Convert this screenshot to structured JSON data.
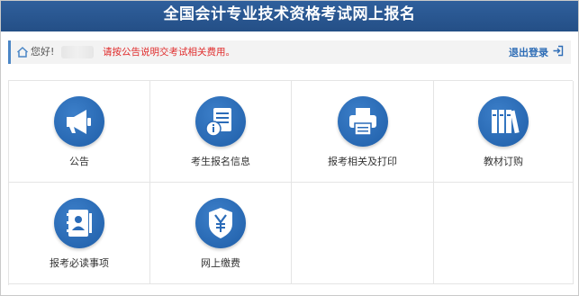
{
  "header": {
    "title": "全国会计专业技术资格考试网上报名"
  },
  "notice": {
    "greeting": "您好!",
    "message": "请按公告说明交考试相关费用。",
    "logout_label": "退出登录"
  },
  "tiles": [
    {
      "label": "公告",
      "icon": "megaphone-icon"
    },
    {
      "label": "考生报名信息",
      "icon": "info-document-icon"
    },
    {
      "label": "报考相关及打印",
      "icon": "printer-icon"
    },
    {
      "label": "教材订购",
      "icon": "books-icon"
    },
    {
      "label": "报考必读事项",
      "icon": "address-book-icon"
    },
    {
      "label": "网上缴费",
      "icon": "yen-shield-icon"
    }
  ],
  "colors": {
    "header": "#2a5790",
    "accent": "#2e6db6",
    "warning": "#e02d2d",
    "icon_circle": "#2a6bb8"
  }
}
